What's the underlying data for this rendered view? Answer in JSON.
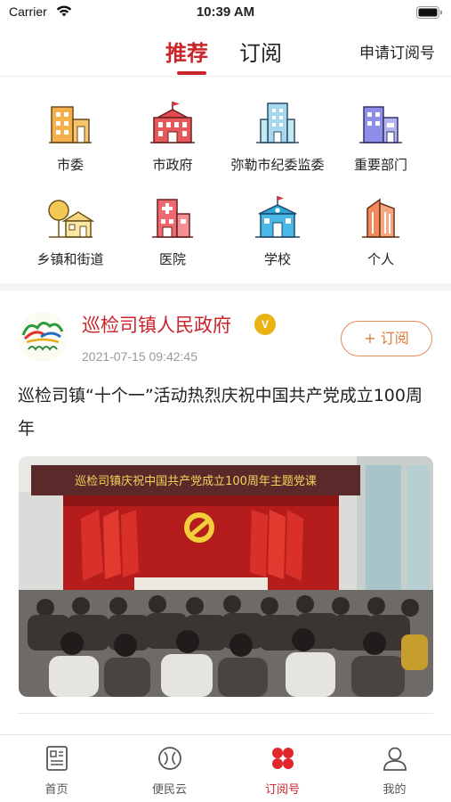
{
  "status_bar": {
    "carrier": "Carrier",
    "time": "10:39 AM"
  },
  "header": {
    "tabs": [
      {
        "label": "推荐",
        "active": true
      },
      {
        "label": "订阅",
        "active": false
      }
    ],
    "apply_link": "申请订阅号",
    "accent_color": "#c9252b"
  },
  "categories": [
    {
      "label": "市委",
      "icon": "office-building-icon"
    },
    {
      "label": "市政府",
      "icon": "government-building-icon"
    },
    {
      "label": "弥勒市纪委监委",
      "icon": "discipline-building-icon"
    },
    {
      "label": "重要部门",
      "icon": "department-building-icon"
    },
    {
      "label": "乡镇和街道",
      "icon": "township-icon"
    },
    {
      "label": "医院",
      "icon": "hospital-icon"
    },
    {
      "label": "学校",
      "icon": "school-icon"
    },
    {
      "label": "个人",
      "icon": "person-building-icon"
    }
  ],
  "article": {
    "publisher": "巡检司镇人民政府",
    "badge": "V",
    "date": "2021-07-15 09:42:45",
    "subscribe_label": "+ 订阅",
    "title": "巡检司镇“十个一”活动热烈庆祝中国共产党成立100周年",
    "photo_banner": "巡检司镇庆祝中国共产党成立100周年主题党课"
  },
  "tabbar": [
    {
      "label": "首页",
      "icon": "news-icon",
      "active": false
    },
    {
      "label": "便民云",
      "icon": "cloud-service-icon",
      "active": false
    },
    {
      "label": "订阅号",
      "icon": "subscription-icon",
      "active": true
    },
    {
      "label": "我的",
      "icon": "profile-icon",
      "active": false
    }
  ]
}
